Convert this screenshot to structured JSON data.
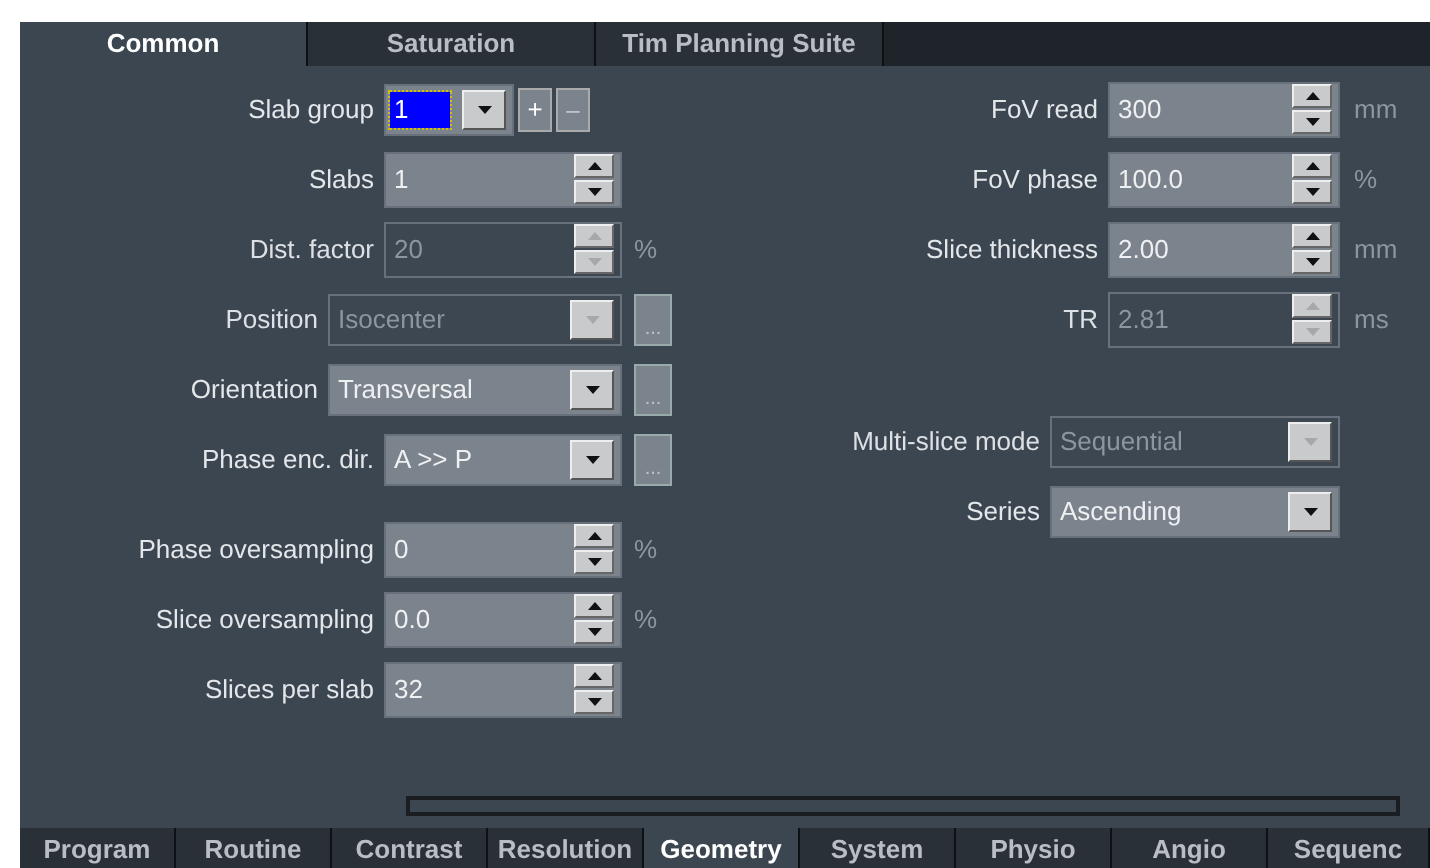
{
  "top_tabs": [
    {
      "label": "Common",
      "selected": true
    },
    {
      "label": "Saturation",
      "selected": false
    },
    {
      "label": "Tim Planning Suite",
      "selected": false
    }
  ],
  "left_groups": [
    [
      {
        "label": "Slab group",
        "kind": "combo",
        "value": "1",
        "disabled": false,
        "plus": "+",
        "minus": "–"
      },
      {
        "label": "Slabs",
        "kind": "spinner",
        "value": "1",
        "disabled": false
      },
      {
        "label": "Dist. factor",
        "kind": "spinner",
        "value": "20",
        "disabled": true,
        "unit": "%"
      },
      {
        "label": "Position",
        "kind": "long-dropdown",
        "value": "Isocenter",
        "disabled": true,
        "more": "..."
      },
      {
        "label": "Orientation",
        "kind": "long-dropdown",
        "value": "Transversal",
        "disabled": false,
        "more": "..."
      },
      {
        "label": "Phase enc. dir.",
        "kind": "dropdown",
        "value": "A >> P",
        "disabled": false,
        "more": "..."
      }
    ],
    [
      {
        "label": "Phase oversampling",
        "kind": "spinner",
        "value": "0",
        "disabled": false,
        "unit": "%"
      },
      {
        "label": "Slice oversampling",
        "kind": "spinner",
        "value": "0.0",
        "disabled": false,
        "unit": "%"
      },
      {
        "label": "Slices per slab",
        "kind": "spinner",
        "value": "32",
        "disabled": false
      }
    ]
  ],
  "right_groups": [
    [
      {
        "label": "FoV read",
        "kind": "spinner",
        "value": "300",
        "disabled": false,
        "unit": "mm"
      },
      {
        "label": "FoV phase",
        "kind": "spinner",
        "value": "100.0",
        "disabled": false,
        "unit": "%"
      },
      {
        "label": "Slice thickness",
        "kind": "spinner",
        "value": "2.00",
        "disabled": false,
        "unit": "mm"
      },
      {
        "label": "TR",
        "kind": "spinner",
        "value": "2.81",
        "disabled": true,
        "unit": "ms"
      }
    ],
    [
      {
        "label": "Multi-slice mode",
        "kind": "long-dropdown",
        "value": "Sequential",
        "disabled": true
      },
      {
        "label": "Series",
        "kind": "long-dropdown",
        "value": "Ascending",
        "disabled": false
      }
    ]
  ],
  "bottom_tabs": [
    {
      "label": "Program",
      "selected": false
    },
    {
      "label": "Routine",
      "selected": false
    },
    {
      "label": "Contrast",
      "selected": false
    },
    {
      "label": "Resolution",
      "selected": false
    },
    {
      "label": "Geometry",
      "selected": true
    },
    {
      "label": "System",
      "selected": false
    },
    {
      "label": "Physio",
      "selected": false
    },
    {
      "label": "Angio",
      "selected": false
    },
    {
      "label": "Sequenc",
      "selected": false
    }
  ]
}
